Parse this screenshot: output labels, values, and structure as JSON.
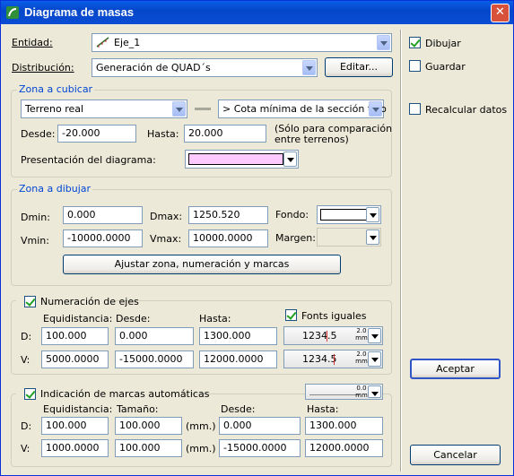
{
  "window": {
    "title": "Diagrama de masas",
    "close_glyph": "✕"
  },
  "top": {
    "entidad_label": "Entidad:",
    "entidad_value": "Eje_1",
    "distribucion_label": "Distribución:",
    "distribucion_value": "Generación de QUAD´s",
    "editar_button": "Editar..."
  },
  "zona_cubicar": {
    "legend": "Zona a cubicar",
    "terrain_value": "Terreno real",
    "cota_value": "> Cota mínima de la sección tipo",
    "desde_label": "Desde:",
    "desde_value": "-20.000",
    "hasta_label": "Hasta:",
    "hasta_value": "20.000",
    "note": "(Sólo para comparación\nentre terrenos)",
    "presentacion_label": "Presentación del diagrama:",
    "presentacion_color": "#ffc8ff"
  },
  "zona_dibujar": {
    "legend": "Zona a dibujar",
    "dmin_label": "Dmin:",
    "dmin_value": "0.000",
    "dmax_label": "Dmax:",
    "dmax_value": "1250.520",
    "fondo_label": "Fondo:",
    "fondo_color": "#ffffff",
    "vmin_label": "Vmin:",
    "vmin_value": "-10000.0000",
    "vmax_label": "Vmax:",
    "vmax_value": "10000.0000",
    "margen_label": "Margen:",
    "ajustar_button": "Ajustar zona, numeración y marcas"
  },
  "numeracion": {
    "legend": "Numeración de ejes",
    "checked": true,
    "fonts_iguales_label": "Fonts iguales",
    "fonts_iguales_checked": true,
    "col_equidistancia": "Equidistancia:",
    "col_desde": "Desde:",
    "col_hasta": "Hasta:",
    "rows": [
      {
        "label": "D:",
        "equidistancia": "100.000",
        "desde": "0.000",
        "hasta": "1300.000",
        "font_value": "1234.5",
        "font_mm_top": "2.0",
        "font_mm_bottom": "mm"
      },
      {
        "label": "V:",
        "equidistancia": "5000.0000",
        "desde": "-15000.0000",
        "hasta": "12000.0000",
        "font_value": "1234.5",
        "font_mm_top": "2.0",
        "font_mm_bottom": "mm"
      }
    ]
  },
  "marcas": {
    "legend": "Indicación de marcas automáticas",
    "checked": true,
    "style_top": "0.0",
    "style_bottom": "mm",
    "col_equidistancia": "Equidistancia:",
    "col_tamano": "Tamaño:",
    "col_desde": "Desde:",
    "col_hasta": "Hasta:",
    "mm_label": "(mm.)",
    "rows": [
      {
        "label": "D:",
        "equidistancia": "100.000",
        "tamano": "100.000",
        "desde": "0.000",
        "hasta": "1300.000"
      },
      {
        "label": "V:",
        "equidistancia": "1000.0000",
        "tamano": "100.000",
        "desde": "-15000.0000",
        "hasta": "12000.0000"
      }
    ]
  },
  "right": {
    "dibujar_label": "Dibujar",
    "dibujar_checked": true,
    "guardar_label": "Guardar",
    "guardar_checked": false,
    "recalcular_label": "Recalcular datos",
    "recalcular_checked": false,
    "aceptar_button": "Aceptar",
    "cancelar_button": "Cancelar"
  }
}
